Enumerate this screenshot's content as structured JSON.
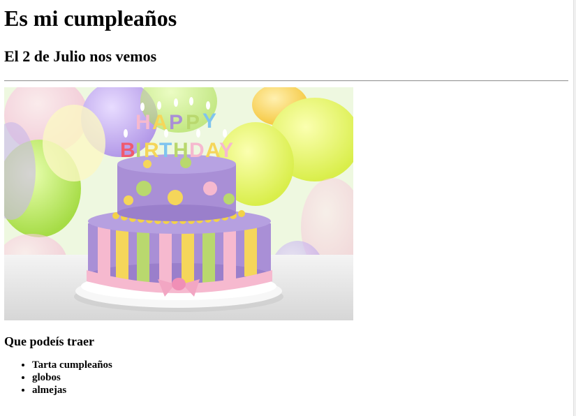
{
  "page": {
    "title": "Es mi cumpleaños",
    "subtitle": "El 2 de Julio nos vemos",
    "image": {
      "icon": "birthday-cake-photo"
    },
    "bring_heading": "Que podeís traer",
    "bring_items": [
      "Tarta cumpleaños",
      "globos",
      "almejas"
    ]
  },
  "colors": {
    "text": "#000000",
    "background": "#ffffff",
    "rule": "#999999",
    "cake_purple": "#a98fd6",
    "cake_yellow": "#f5d65a",
    "cake_green": "#b9d86e",
    "ribbon_pink": "#f6b9cf"
  }
}
